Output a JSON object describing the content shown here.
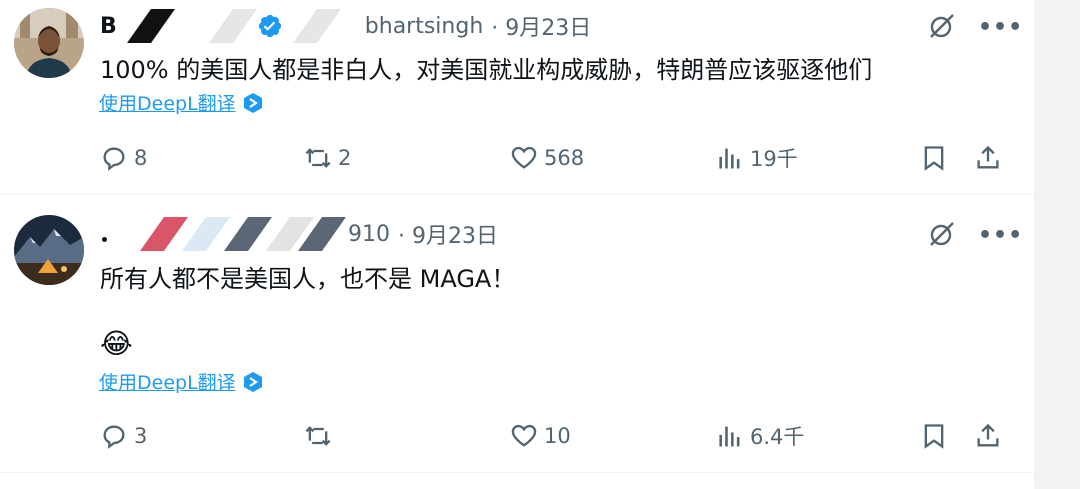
{
  "tweets": [
    {
      "name_prefix": "B",
      "handle_suffix": "bhartsingh",
      "date": "· 9月23日",
      "text": "100% 的美国人都是非白人，对美国就业构成威胁，特朗普应该驱逐他们",
      "emoji": "",
      "translate_label": "使用DeepL翻译",
      "replies": "8",
      "retweets": "2",
      "likes": "568",
      "views": "19千"
    },
    {
      "name_prefix": "",
      "handle_suffix": "910",
      "date": "· 9月23日",
      "text": "所有人都不是美国人，也不是 MAGA！",
      "emoji": "😂",
      "translate_label": "使用DeepL翻译",
      "replies": "3",
      "retweets": "",
      "likes": "10",
      "views": "6.4千"
    }
  ],
  "colors": {
    "accent": "#1d9bf0",
    "muted": "#536471",
    "text": "#0f1419",
    "verified": "#1d9bf0"
  }
}
